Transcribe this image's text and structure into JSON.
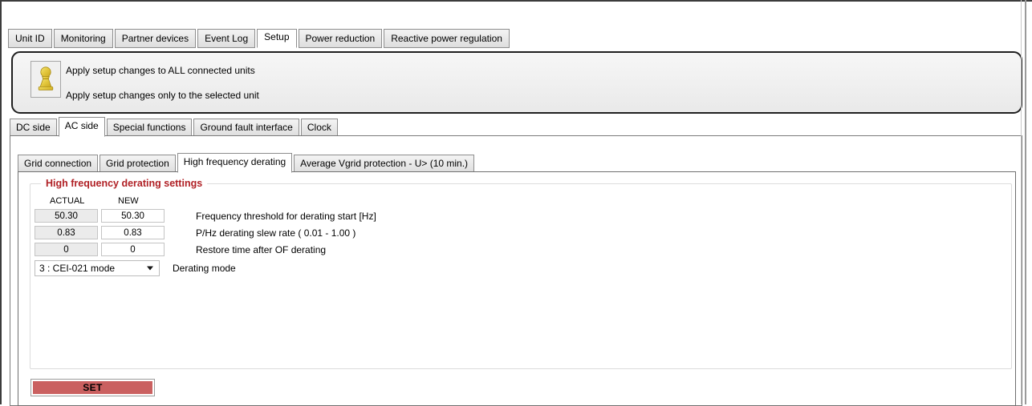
{
  "window": {
    "tabs_level1": [
      {
        "label": "Unit ID",
        "selected": false
      },
      {
        "label": "Monitoring",
        "selected": false
      },
      {
        "label": "Partner devices",
        "selected": false
      },
      {
        "label": "Event Log",
        "selected": false
      },
      {
        "label": "Setup",
        "selected": true
      },
      {
        "label": "Power reduction",
        "selected": false
      },
      {
        "label": "Reactive power regulation",
        "selected": false
      }
    ]
  },
  "apply_panel": {
    "icon": "pawn-icon",
    "line1": "Apply setup changes to ALL connected units",
    "line2": "Apply setup changes only to the selected unit"
  },
  "tabs_level2": [
    {
      "label": "DC side",
      "selected": false
    },
    {
      "label": "AC side",
      "selected": true
    },
    {
      "label": "Special functions",
      "selected": false
    },
    {
      "label": "Ground fault interface",
      "selected": false
    },
    {
      "label": "Clock",
      "selected": false
    }
  ],
  "tabs_level3": [
    {
      "label": "Grid connection",
      "selected": false
    },
    {
      "label": "Grid protection",
      "selected": false
    },
    {
      "label": "High frequency derating",
      "selected": true
    },
    {
      "label": "Average Vgrid protection - U> (10 min.)",
      "selected": false
    }
  ],
  "groupbox": {
    "title": "High frequency derating settings",
    "title_color": "#b02025",
    "column_actual": "ACTUAL",
    "column_new": "NEW",
    "rows": [
      {
        "actual": "50.30",
        "new": "50.30",
        "label": "Frequency threshold for derating start [Hz]"
      },
      {
        "actual": "0.83",
        "new": "0.83",
        "label": "P/Hz derating slew rate ( 0.01 - 1.00 )"
      },
      {
        "actual": "0",
        "new": "0",
        "label": "Restore time after OF derating"
      }
    ],
    "derating_mode": {
      "value": "3 : CEI-021 mode",
      "label": "Derating mode",
      "arrow_icon": "chevron-down-icon"
    }
  },
  "set_button": {
    "label": "SET",
    "color": "#ca6060"
  }
}
